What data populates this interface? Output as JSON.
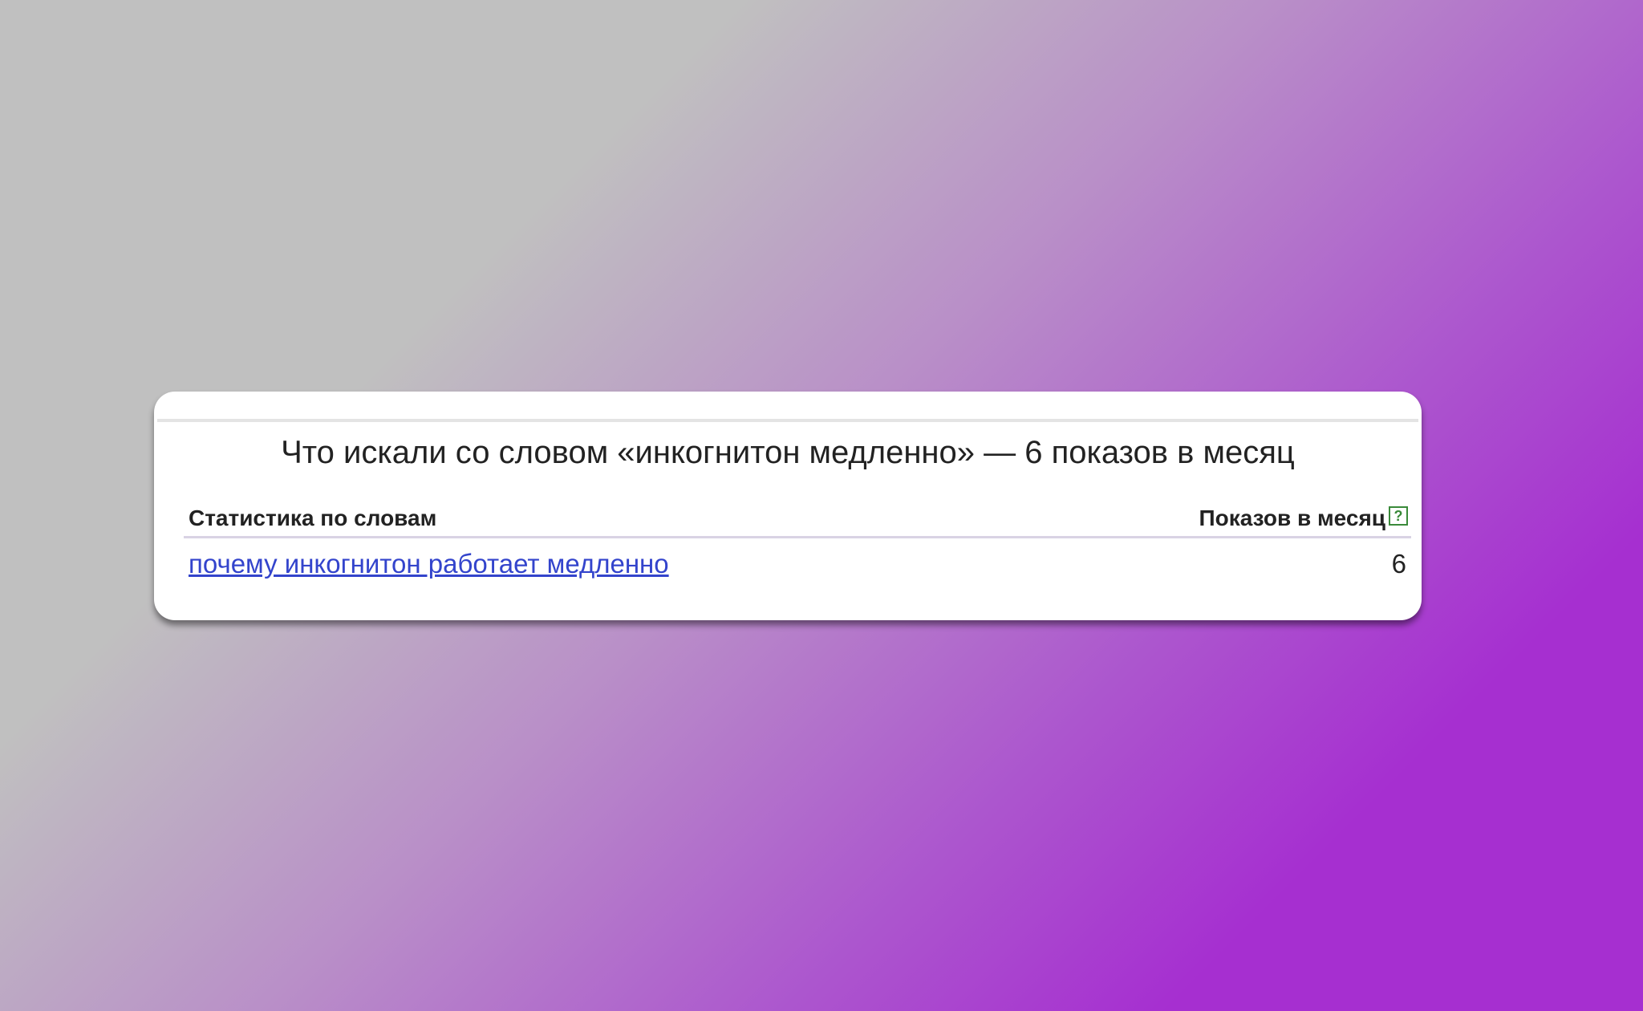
{
  "card": {
    "title": "Что искали со словом «инкогнитон медленно» — 6 показов в месяц"
  },
  "table": {
    "headers": {
      "words": "Статистика по словам",
      "shows": "Показов в месяц",
      "help": "?"
    },
    "rows": [
      {
        "phrase": "почему инкогнитон работает медленно",
        "count": "6"
      }
    ]
  },
  "colors": {
    "link": "#3344cc",
    "help_icon": "#3a8a3a"
  },
  "icons": {
    "help": "question-mark-icon"
  }
}
